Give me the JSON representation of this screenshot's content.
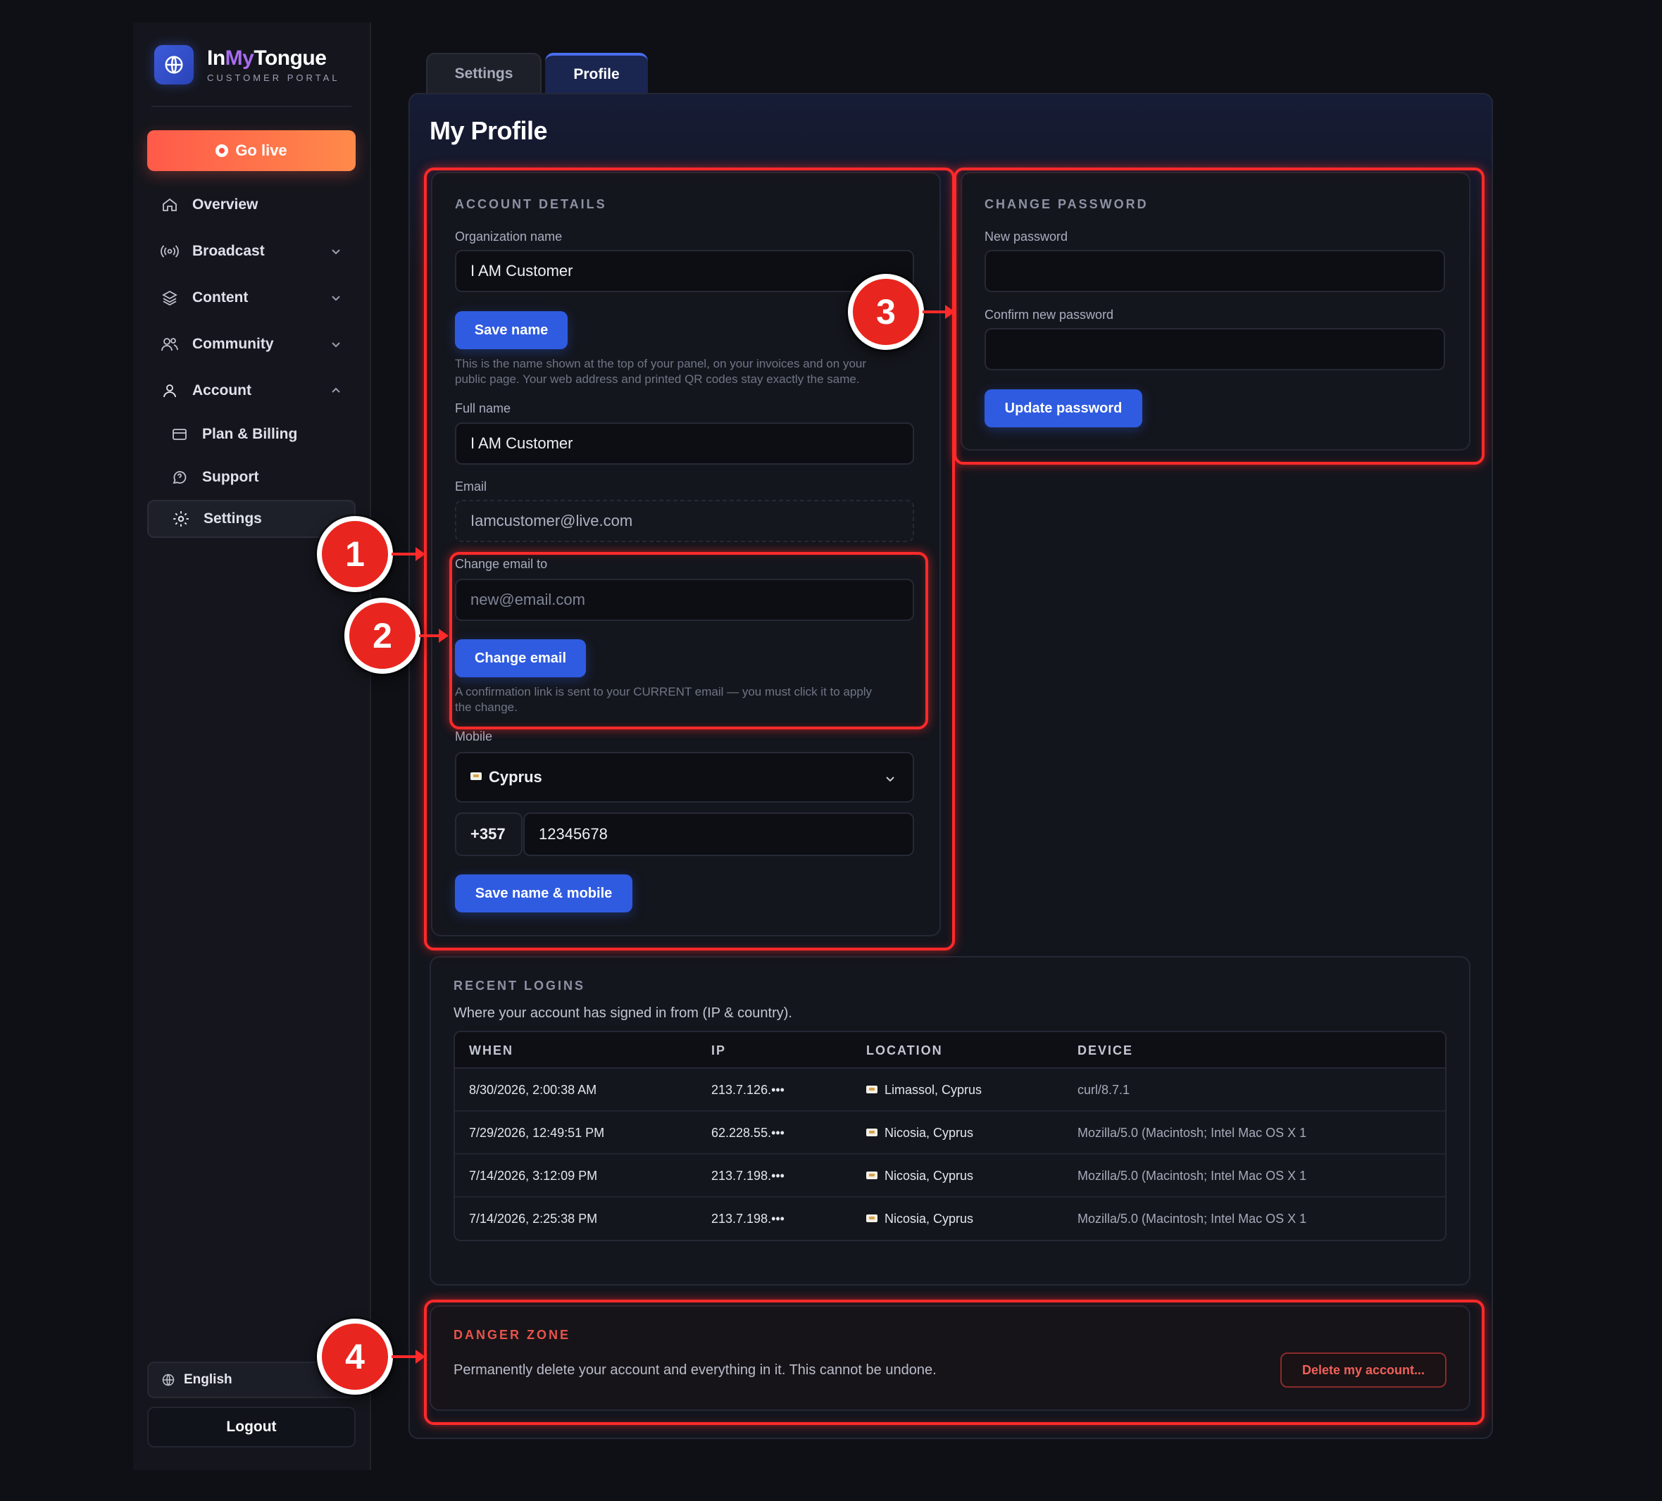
{
  "brand": {
    "name_prefix": "In",
    "name_accent": "My",
    "name_suffix": "Tongue",
    "subtitle": "CUSTOMER PORTAL"
  },
  "sidebar": {
    "go_live": "Go live",
    "items": [
      {
        "label": "Overview",
        "icon": "home-icon"
      },
      {
        "label": "Broadcast",
        "icon": "broadcast-icon"
      },
      {
        "label": "Content",
        "icon": "layers-icon"
      },
      {
        "label": "Community",
        "icon": "users-icon"
      },
      {
        "label": "Account",
        "icon": "user-icon"
      },
      {
        "label": "Plan & Billing",
        "icon": "card-icon"
      },
      {
        "label": "Support",
        "icon": "chat-icon"
      },
      {
        "label": "Settings",
        "icon": "gear-icon"
      }
    ],
    "language": "English",
    "logout": "Logout"
  },
  "tabs": {
    "settings": "Settings",
    "profile": "Profile"
  },
  "page_title": "My Profile",
  "account_details": {
    "title": "ACCOUNT DETAILS",
    "org_label": "Organization name",
    "org_value": "I AM Customer",
    "save_name": "Save name",
    "org_hint_line1": "This is the name shown at the top of your panel, on your invoices and on your",
    "org_hint_line2": "public page. Your web address and printed QR codes stay exactly the same.",
    "full_name_label": "Full name",
    "full_name_value": "I AM Customer",
    "email_label": "Email",
    "email_value": "Iamcustomer@live.com",
    "change_email_label": "Change email to",
    "change_email_placeholder": "new@email.com",
    "change_email_button": "Change email",
    "change_email_hint_line1": "A confirmation link is sent to your CURRENT email — you must click it to apply",
    "change_email_hint_line2": "the change.",
    "mobile_label": "Mobile",
    "country": "Cyprus",
    "dial_code": "+357",
    "phone": "12345678",
    "save_name_mobile": "Save name & mobile"
  },
  "change_password": {
    "title": "CHANGE PASSWORD",
    "new_label": "New password",
    "confirm_label": "Confirm new password",
    "button": "Update password"
  },
  "recent_logins": {
    "title": "RECENT LOGINS",
    "subtitle": "Where your account has signed in from (IP & country).",
    "headers": [
      "WHEN",
      "IP",
      "LOCATION",
      "DEVICE"
    ],
    "rows": [
      {
        "when": "8/30/2026, 2:00:38 AM",
        "ip": "213.7.126.•••",
        "location": "Limassol, Cyprus",
        "device": "curl/8.7.1"
      },
      {
        "when": "7/29/2026, 12:49:51 PM",
        "ip": "62.228.55.•••",
        "location": "Nicosia, Cyprus",
        "device": "Mozilla/5.0 (Macintosh; Intel Mac OS X 1"
      },
      {
        "when": "7/14/2026, 3:12:09 PM",
        "ip": "213.7.198.•••",
        "location": "Nicosia, Cyprus",
        "device": "Mozilla/5.0 (Macintosh; Intel Mac OS X 1"
      },
      {
        "when": "7/14/2026, 2:25:38 PM",
        "ip": "213.7.198.•••",
        "location": "Nicosia, Cyprus",
        "device": "Mozilla/5.0 (Macintosh; Intel Mac OS X 1"
      }
    ]
  },
  "danger_zone": {
    "title": "DANGER ZONE",
    "text": "Permanently delete your account and everything in it. This cannot be undone.",
    "button": "Delete my account..."
  },
  "annotations": {
    "m1": "1",
    "m2": "2",
    "m3": "3",
    "m4": "4"
  },
  "colors": {
    "accent": "#2f5be0",
    "brand_live": "#ff5a4a",
    "highlight": "#ff2a2a",
    "danger": "#e8534a"
  }
}
